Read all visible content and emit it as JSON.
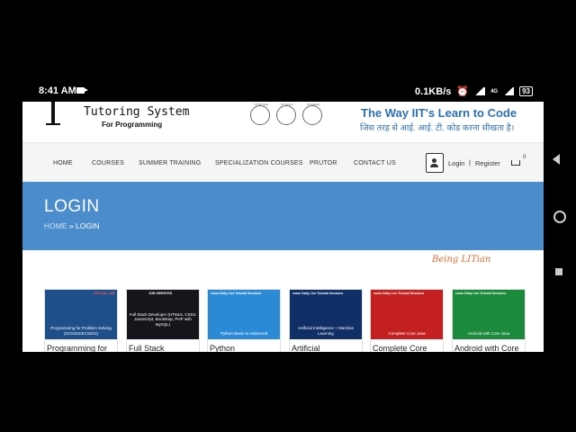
{
  "status_bar": {
    "time": "8:41 AM",
    "net_speed": "0.1KB/s",
    "network": "4G",
    "battery": "93"
  },
  "brand": {
    "title": "Tutoring System",
    "subtitle": "For Programming"
  },
  "partners": [
    {
      "top": "IIT Bombay",
      "bottom": "IISc Bangalore"
    },
    {
      "top": "IIT Kanpur",
      "bottom": "IIT Goa"
    },
    {
      "top": "IIT Madras",
      "bottom": "IIIT-D Mandi"
    }
  ],
  "tagline": {
    "en": "The Way IIT's Learn to Code",
    "hi": "जिस तरह से आई. आई. टी. कोड करना सीखता है।"
  },
  "nav": {
    "items": [
      "HOME",
      "COURSES",
      "SUMMER TRAINING",
      "SPECIALIZATION COURSES",
      "PRUTOR",
      "CONTACT US"
    ],
    "login": "Login",
    "separator": "|",
    "register": "Register",
    "cart_count": "0"
  },
  "banner": {
    "title": "LOGIN",
    "crumb_home": "HOME",
    "crumb_sep": "»",
    "crumb_current": "LOGIN"
  },
  "cards": [
    {
      "caption": "Programming for Problem Solving (KCS101/KCS201)",
      "title": "Programming for",
      "bg": "#1f4f8a",
      "tag": "VIRTUAL LAB"
    },
    {
      "caption": "Full Stack Developer (HTML5, CSS3, JavaScript, Bootstrap, PHP with MySQL)",
      "title": "Full Stack",
      "bg": "#14161c",
      "tag": "JOB ORIENTED"
    },
    {
      "caption": "Python Basic to Advanced",
      "title": "Python",
      "bg": "#2a8ad6",
      "tag": "zoom Daily Live Tutorial Sessions"
    },
    {
      "caption": "Artificial Intelligence + Machine Learning",
      "title": "Artificial",
      "bg": "#0f2f66",
      "tag": "zoom Daily Live Tutorial Sessions"
    },
    {
      "caption": "Complete Core Java",
      "title": "Complete Core",
      "bg": "#c42020",
      "tag": "zoom Daily Live Tutorial Sessions"
    },
    {
      "caption": "Android with Core Java",
      "title": "Android with Core",
      "bg": "#1b8a3a",
      "tag": "zoom Daily Live Tutorial Sessions"
    }
  ],
  "watermark": "Being LITian"
}
